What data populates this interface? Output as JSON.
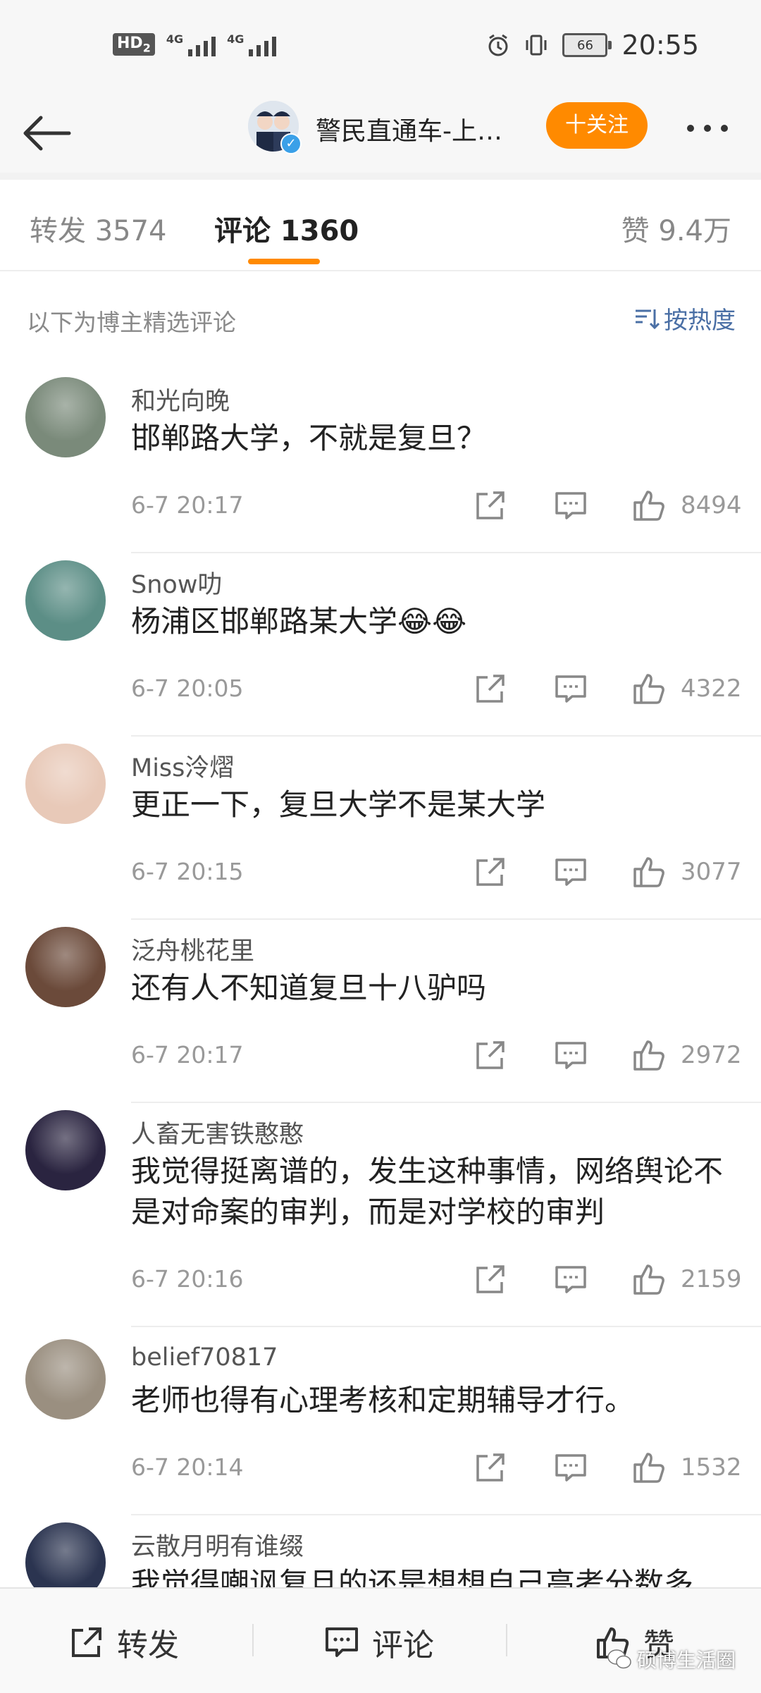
{
  "status_bar": {
    "hd_label": "HD",
    "hd_sub": "2",
    "net1": "4G",
    "net2": "4G",
    "battery": "66",
    "time": "20:55"
  },
  "header": {
    "title": "警民直通车-上…",
    "follow_label": "十关注"
  },
  "tabs": {
    "repost": "转发 3574",
    "comment": "评论 1360",
    "like": "赞 9.4万"
  },
  "filter": {
    "label": "以下为博主精选评论",
    "sort_label": "按热度"
  },
  "comments": [
    {
      "user": "和光向晚",
      "text": "邯郸路大学，不就是复旦？",
      "time": "6-7 20:17",
      "likes": "8494",
      "avatar_color": "#7a8a7a"
    },
    {
      "user": "Snow叻",
      "text": "杨浦区邯郸路某大学😂😂",
      "time": "6-7 20:05",
      "likes": "4322",
      "avatar_color": "#5c8e86"
    },
    {
      "user": "Miss泠熠",
      "text": "更正一下，复旦大学不是某大学",
      "time": "6-7 20:15",
      "likes": "3077",
      "avatar_color": "#e8c9b8"
    },
    {
      "user": "泛舟桃花里",
      "text": "还有人不知道复旦十八驴吗",
      "time": "6-7 20:17",
      "likes": "2972",
      "avatar_color": "#6b4a3a"
    },
    {
      "user": "人畜无害铁憨憨",
      "text": "我觉得挺离谱的，发生这种事情，网络舆论不是对命案的审判，而是对学校的审判",
      "time": "6-7 20:16",
      "likes": "2159",
      "avatar_color": "#2a2440"
    },
    {
      "user": "belief70817",
      "text": "老师也得有心理考核和定期辅导才行。",
      "time": "6-7 20:14",
      "likes": "1532",
      "avatar_color": "#9a8f80"
    },
    {
      "user": "云散月明有谁缀",
      "text": "我觉得嘲讽复旦的还是想想自己高考分数多",
      "time": "",
      "likes": "",
      "avatar_color": "#2b3450"
    }
  ],
  "bottom": {
    "repost": "转发",
    "comment": "评论",
    "like": "赞",
    "watermark": "硕博生活圈"
  }
}
